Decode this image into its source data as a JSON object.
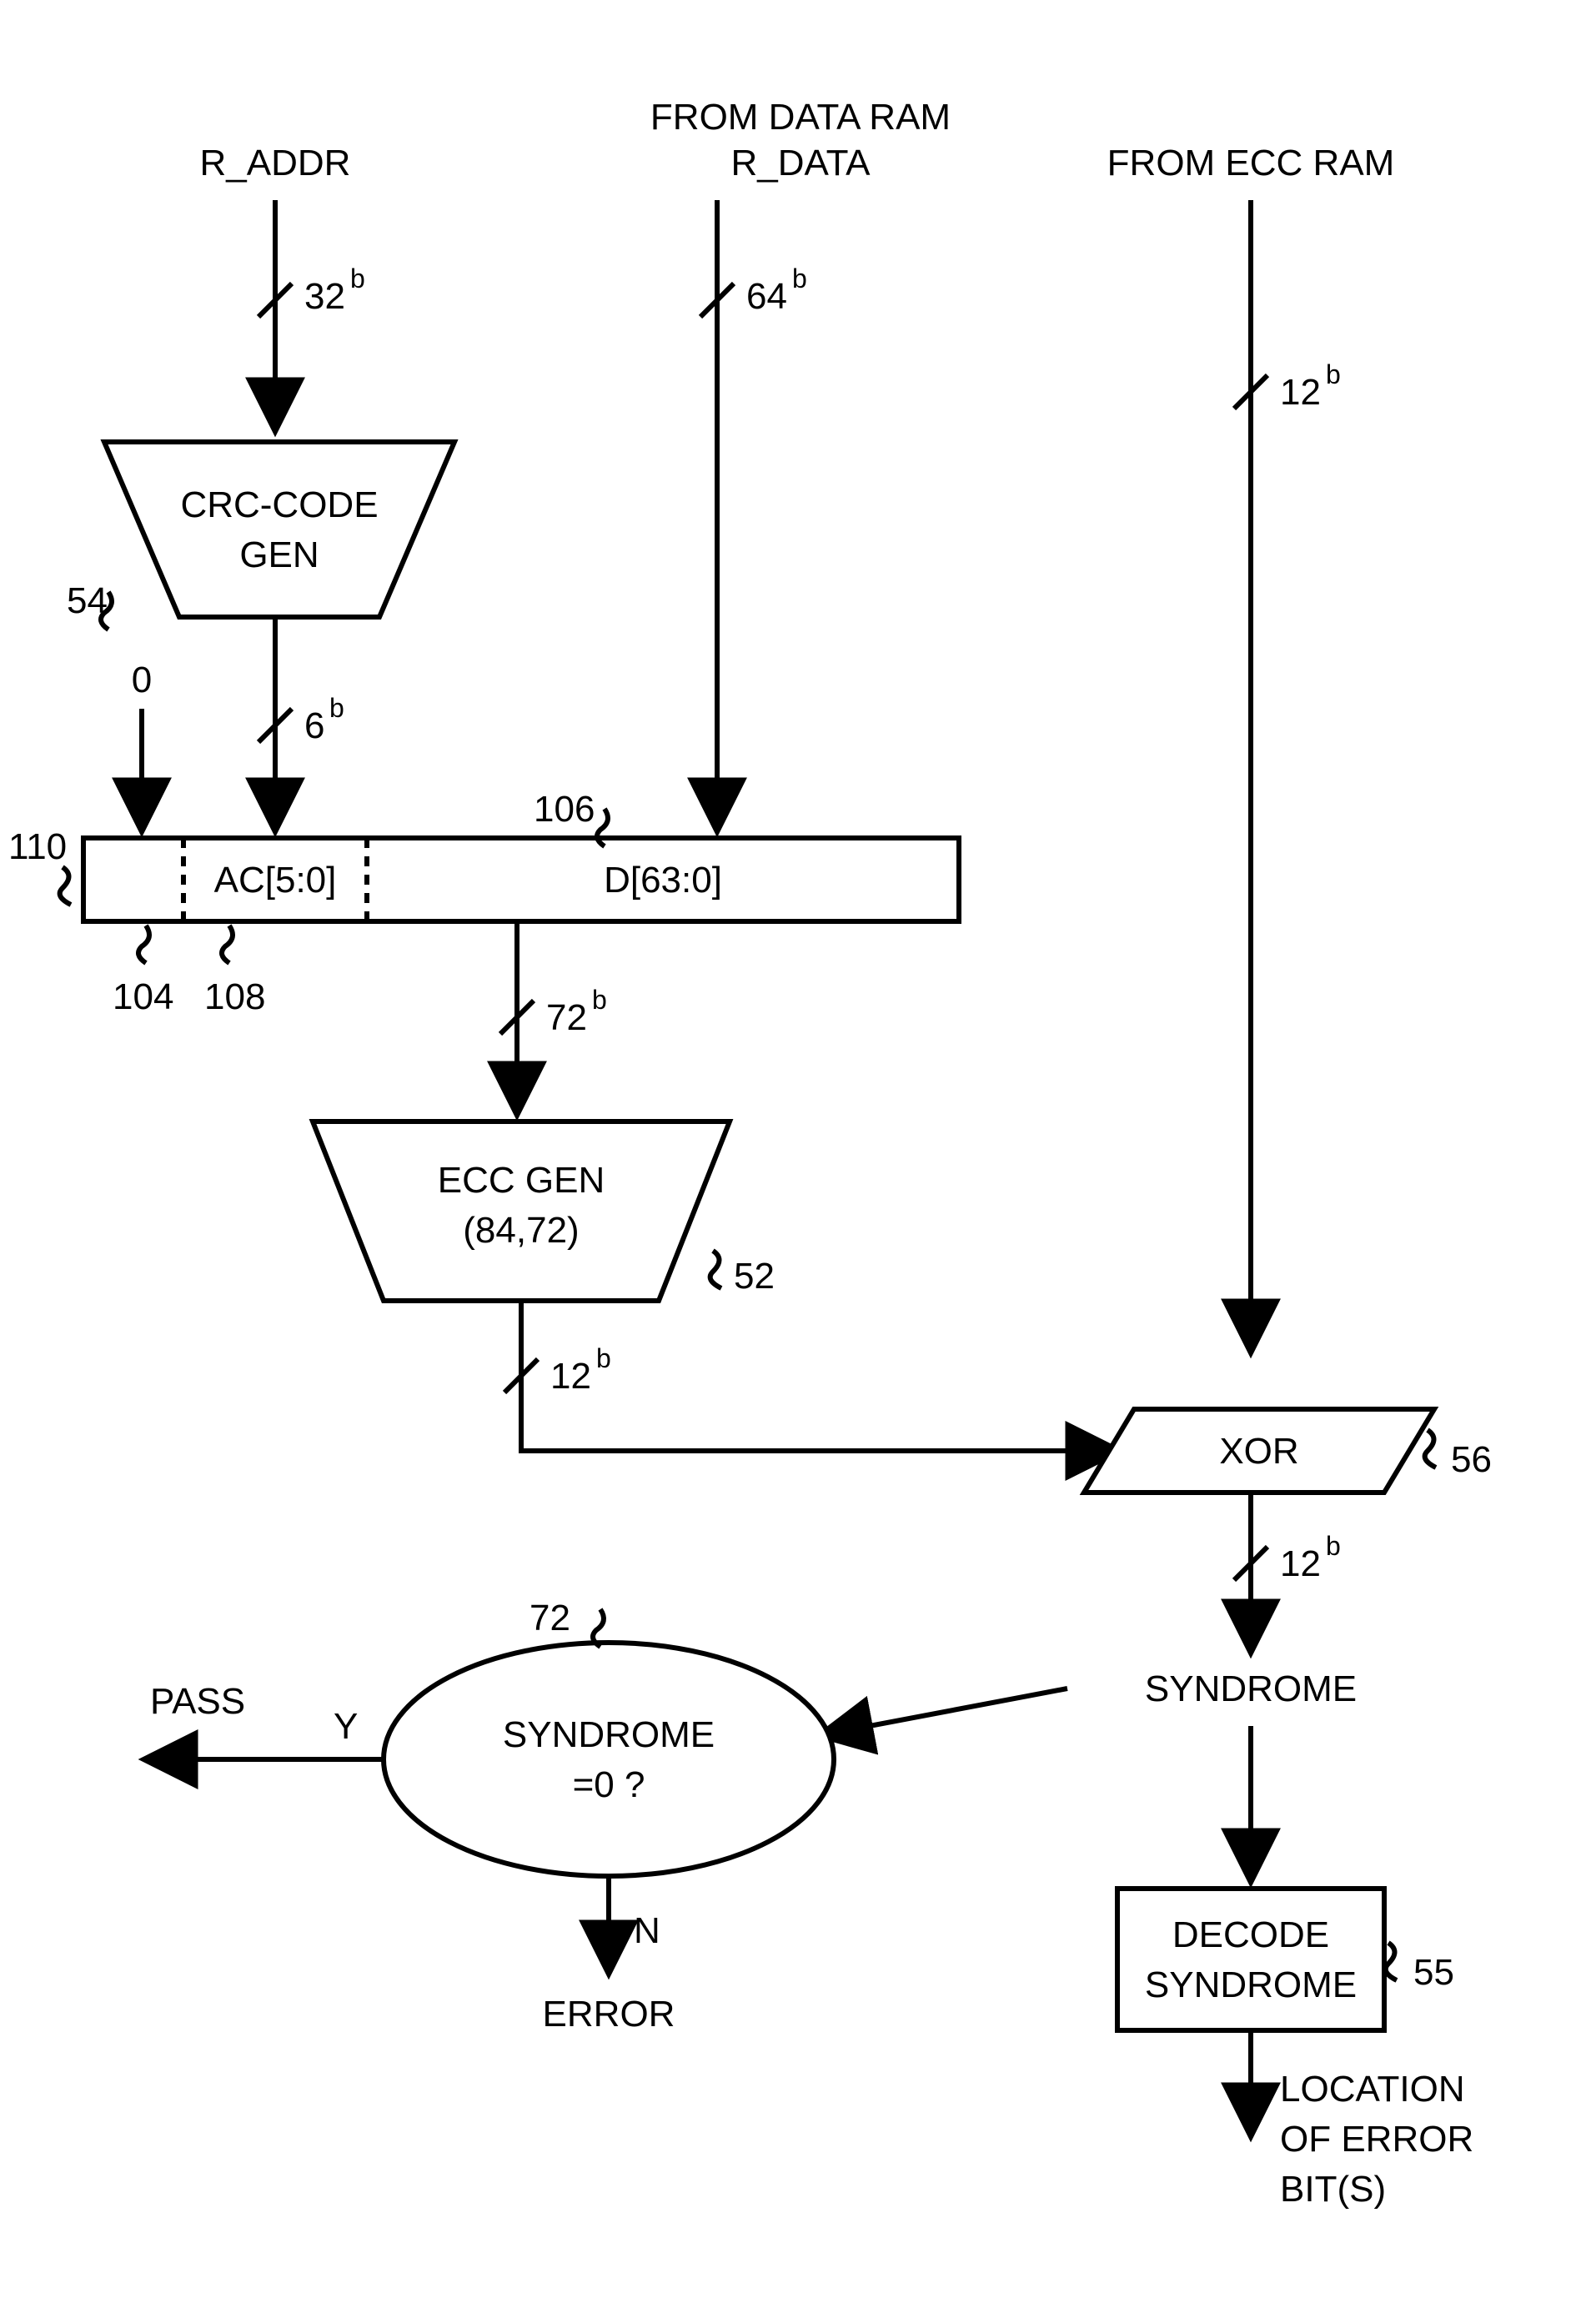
{
  "inputs": {
    "r_addr": "R_ADDR",
    "from_data_ram": "FROM  DATA  RAM",
    "r_data": "R_DATA",
    "from_ecc_ram": "FROM ECC RAM"
  },
  "bus": {
    "w32": "32",
    "w64": "64",
    "w12": "12",
    "w6": "6",
    "w72": "72",
    "unit": "b"
  },
  "blocks": {
    "crc_l1": "CRC-CODE",
    "crc_l2": "GEN",
    "reg_ac": "AC[5:0]",
    "reg_d": "D[63:0]",
    "ecc_l1": "ECC GEN",
    "ecc_l2": "(84,72)",
    "xor": "XOR",
    "syndrome_eq_l1": "SYNDROME",
    "syndrome_eq_l2": "=0 ?",
    "decode_l1": "DECODE",
    "decode_l2": "SYNDROME",
    "zero_in": "0"
  },
  "labels": {
    "pass": "PASS",
    "yes": "Y",
    "no": "N",
    "error": "ERROR",
    "syndrome": "SYNDROME",
    "loc_l1": "LOCATION",
    "loc_l2": "OF ERROR",
    "loc_l3": "BIT(S)"
  },
  "refs": {
    "r54": "54",
    "r110": "110",
    "r104": "104",
    "r108": "108",
    "r106": "106",
    "r52": "52",
    "r56": "56",
    "r72": "72",
    "r55": "55"
  }
}
